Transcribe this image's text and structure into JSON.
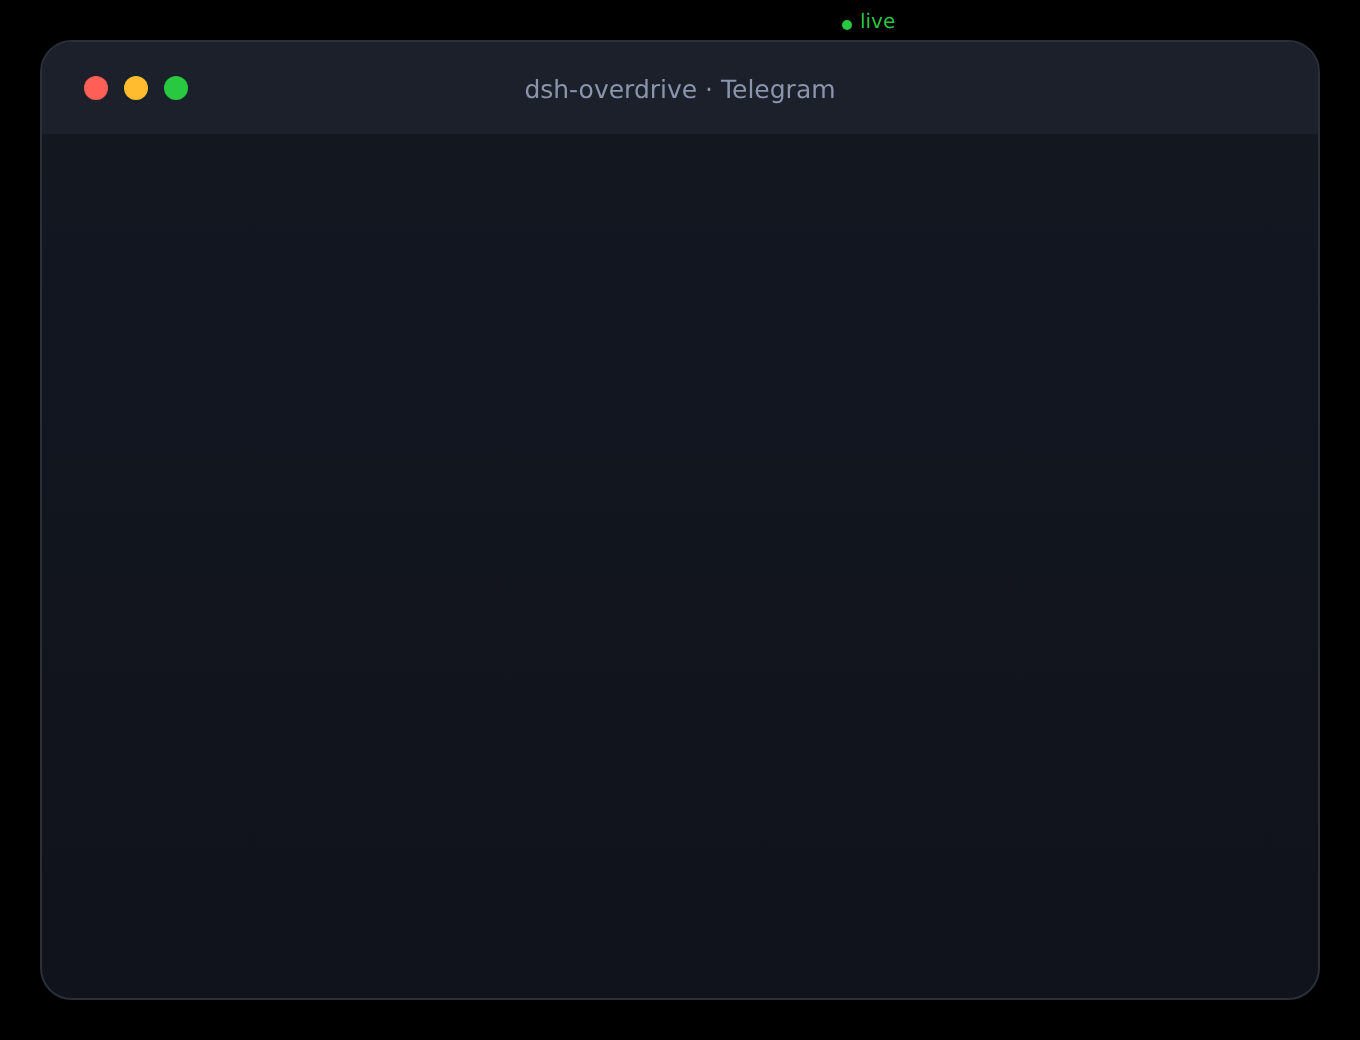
{
  "status": {
    "label": "live"
  },
  "window": {
    "title": "dsh-overdrive · Telegram"
  }
}
